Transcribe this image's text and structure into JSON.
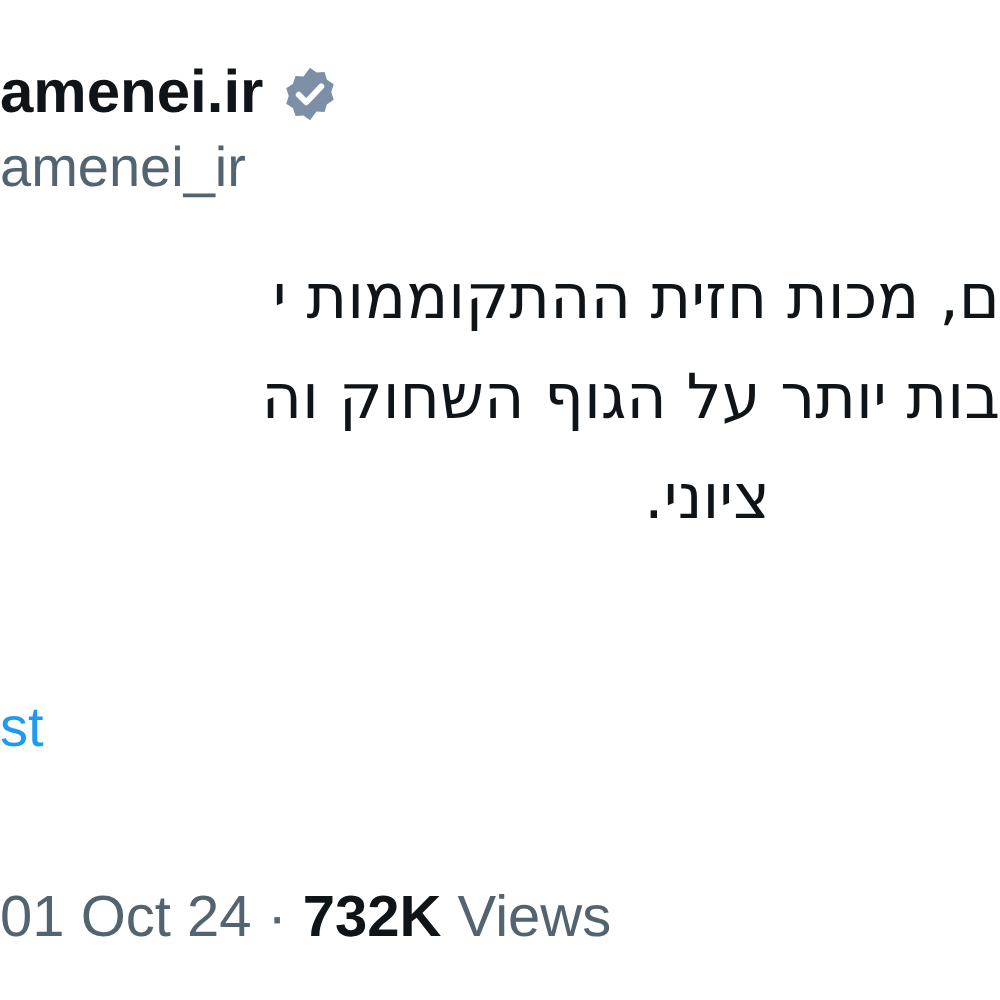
{
  "author": {
    "display_name": "amenei.ir",
    "verified": true,
    "handle": "amenei_ir"
  },
  "post": {
    "lines": [
      "ם, מכות חזית ההתקוממות י",
      "בות יותר על הגוף השחוק וה",
      "ציוני."
    ],
    "translate_link": "st"
  },
  "meta": {
    "date": "01 Oct 24",
    "separator": "·",
    "views_count": "732K",
    "views_label": "Views"
  }
}
